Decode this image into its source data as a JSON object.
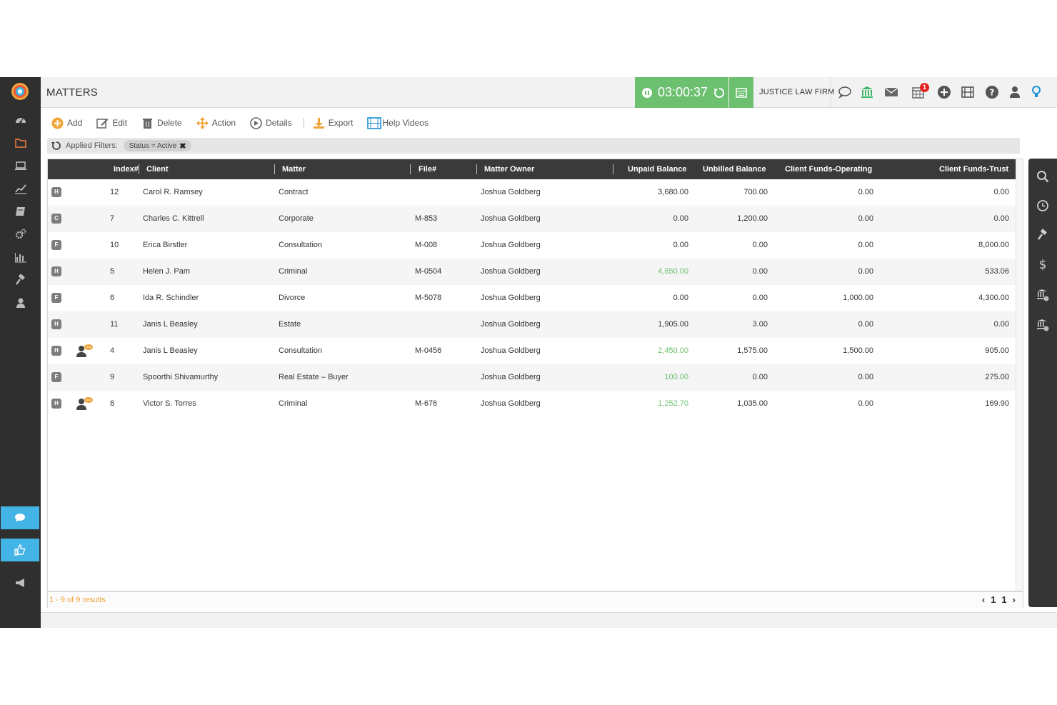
{
  "header": {
    "title": "MATTERS",
    "timer": "03:00:37",
    "firm_name": "JUSTICE LAW FIRM",
    "calendar_badge": "1"
  },
  "toolbar": {
    "add": "Add",
    "edit": "Edit",
    "delete": "Delete",
    "action": "Action",
    "details": "Details",
    "export": "Export",
    "help_videos": "Help Videos"
  },
  "filters": {
    "label": "Applied Filters:",
    "chip": "Status = Active"
  },
  "table": {
    "columns": {
      "index": "Index#",
      "client": "Client",
      "matter": "Matter",
      "file": "File#",
      "owner": "Matter Owner",
      "unpaid": "Unpaid Balance",
      "unbilled": "Unbilled Balance",
      "operating": "Client Funds-Operating",
      "trust": "Client Funds-Trust"
    },
    "rows": [
      {
        "type": "H",
        "index": "12",
        "client": "Carol R. Ramsey",
        "matter": "Contract",
        "file": "",
        "owner": "Joshua Goldberg",
        "unpaid": "3,680.00",
        "unbilled": "700.00",
        "operating": "0.00",
        "trust": "0.00"
      },
      {
        "type": "C",
        "index": "7",
        "client": "Charles C. Kittrell",
        "matter": "Corporate",
        "file": "M-853",
        "owner": "Joshua Goldberg",
        "unpaid": "0.00",
        "unbilled": "1,200.00",
        "operating": "0.00",
        "trust": "0.00"
      },
      {
        "type": "F",
        "index": "10",
        "client": "Erica Birstler",
        "matter": "Consultation",
        "file": "M-008",
        "owner": "Joshua Goldberg",
        "unpaid": "0.00",
        "unbilled": "0.00",
        "operating": "0.00",
        "trust": "8,000.00"
      },
      {
        "type": "H",
        "index": "5",
        "client": "Helen J. Pam",
        "matter": "Criminal",
        "file": "M-0504",
        "owner": "Joshua Goldberg",
        "unpaid": "4,850.00",
        "unbilled": "0.00",
        "operating": "0.00",
        "trust": "533.06"
      },
      {
        "type": "F",
        "index": "6",
        "client": "Ida R. Schindler",
        "matter": "Divorce",
        "file": "M-5078",
        "owner": "Joshua Goldberg",
        "unpaid": "0.00",
        "unbilled": "0.00",
        "operating": "1,000.00",
        "trust": "4,300.00"
      },
      {
        "type": "H",
        "index": "11",
        "client": "Janis L Beasley",
        "matter": "Estate",
        "file": "",
        "owner": "Joshua Goldberg",
        "unpaid": "1,905.00",
        "unbilled": "3.00",
        "operating": "0.00",
        "trust": "0.00"
      },
      {
        "type": "H",
        "index": "4",
        "client": "Janis L Beasley",
        "matter": "Consultation",
        "file": "M-0456",
        "owner": "Joshua Goldberg",
        "unpaid": "2,450.00",
        "unbilled": "1,575.00",
        "operating": "1,500.00",
        "trust": "905.00"
      },
      {
        "type": "F",
        "index": "9",
        "client": "Spoorthi Shivamurthy",
        "matter": "Real Estate – Buyer",
        "file": "",
        "owner": "Joshua Goldberg",
        "unpaid": "100.00",
        "unbilled": "0.00",
        "operating": "0.00",
        "trust": "275.00"
      },
      {
        "type": "H",
        "index": "8",
        "client": "Victor S. Torres",
        "matter": "Criminal",
        "file": "M-676",
        "owner": "Joshua Goldberg",
        "unpaid": "1,252.70",
        "unbilled": "1,035.00",
        "operating": "0.00",
        "trust": "169.90"
      }
    ],
    "green_unpaid_rows": [
      3,
      6,
      7,
      8
    ],
    "shared_rows": [
      6,
      8
    ]
  },
  "footer": {
    "results": "1 - 9 of 9 results",
    "prev": "‹",
    "page": "1",
    "total": "1",
    "next": "›"
  },
  "colors": {
    "sidebar": "#2f2f2f",
    "timer": "#6cc070",
    "accent_blue": "#42b4e6",
    "orange": "#f0a43a",
    "green_text": "#6cc070"
  },
  "icons": {
    "sidebar": [
      "dashboard-icon",
      "folder-icon",
      "laptop-icon",
      "chart-icon",
      "book-icon",
      "settings-icon",
      "report-icon",
      "gavel-icon",
      "user-icon"
    ],
    "right_panel": [
      "search-icon",
      "clock-icon",
      "gavel-icon",
      "dollar-icon",
      "bank-icon",
      "bank-icon"
    ]
  }
}
